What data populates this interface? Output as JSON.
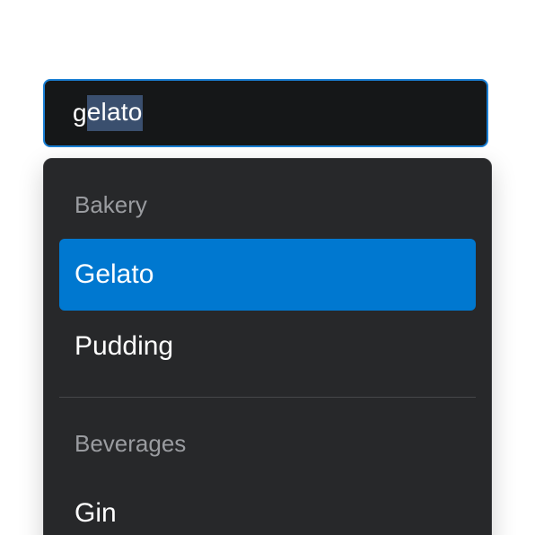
{
  "input": {
    "typed": "g",
    "completion": "elato"
  },
  "listbox": {
    "groups": [
      {
        "label": "Bakery",
        "options": [
          {
            "label": "Gelato",
            "selected": true
          },
          {
            "label": "Pudding",
            "selected": false
          }
        ]
      },
      {
        "label": "Beverages",
        "options": [
          {
            "label": "Gin",
            "selected": false
          }
        ]
      }
    ]
  },
  "colors": {
    "input_background": "#151718",
    "focus_border": "#1a7fd4",
    "selection_highlight": "#3a4f6e",
    "listbox_background": "#27282a",
    "selected_option": "#0078d0",
    "group_label": "#9a9ca0"
  }
}
